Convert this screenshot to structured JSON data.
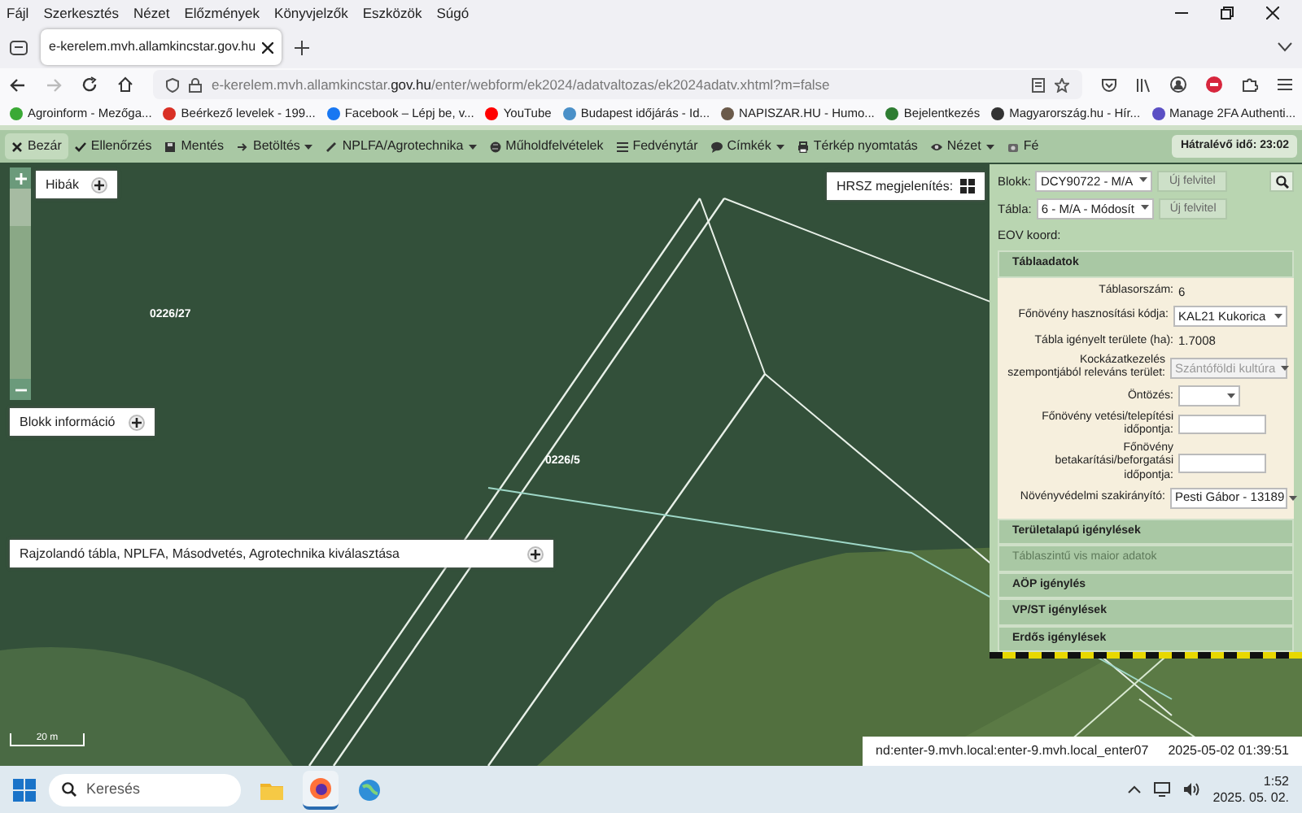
{
  "menu_bar": {
    "items": [
      "Fájl",
      "Szerkesztés",
      "Nézet",
      "Előzmények",
      "Könyvjelzők",
      "Eszközök",
      "Súgó"
    ]
  },
  "tabs": [
    {
      "label": "e-kerelem.mvh.allamkincstar.gov.hu",
      "selected": true
    }
  ],
  "address_bar": {
    "url": "e-kerelem.mvh.allamkincstar.**gov.hu**/enter/webform/ek2024/adatvaltozas/ek2024adatv.xhtml?m=false"
  },
  "bookmarks": [
    {
      "label": "Agroinform - Mezőga...",
      "color": "#3aa935"
    },
    {
      "label": "Beérkező levelek - 199...",
      "color": "#d93025"
    },
    {
      "label": "Facebook – Lépj be, v...",
      "color": "#1877f2"
    },
    {
      "label": "YouTube",
      "color": "#ff0000"
    },
    {
      "label": "Budapest időjárás - Id...",
      "color": "#4a90c8"
    },
    {
      "label": "NAPISZAR.HU - Humo...",
      "color": "#6b5a4a"
    },
    {
      "label": "Bejelentkezés",
      "color": "#2e7d32"
    },
    {
      "label": "Magyarország.hu - Hír...",
      "color": "#333333"
    },
    {
      "label": "Manage 2FA Authenti...",
      "color": "#5b4fc4"
    }
  ],
  "toolbar": {
    "items": [
      {
        "label": "Bezár",
        "kind": "close"
      },
      {
        "label": "Ellenőrzés",
        "kind": "check"
      },
      {
        "label": "Mentés",
        "kind": "save"
      },
      {
        "label": "Betöltés",
        "kind": "load",
        "dropdown": true
      },
      {
        "label": "NPLFA/Agrotechnika",
        "kind": "pencil",
        "dropdown": true
      },
      {
        "label": "Műholdfelvételek",
        "kind": "globe"
      },
      {
        "label": "Fedvénytár",
        "kind": "list"
      },
      {
        "label": "Címkék",
        "kind": "comment",
        "dropdown": true
      },
      {
        "label": "Térkép nyomtatás",
        "kind": "print"
      },
      {
        "label": "Nézet",
        "kind": "eye",
        "dropdown": true
      },
      {
        "label": "Fé",
        "kind": "camera"
      }
    ],
    "session_timer": "Hátralévő idő: 23:02"
  },
  "map": {
    "panels": [
      {
        "label": "Hibák",
        "kind": "errors"
      },
      {
        "label": "Blokk információ",
        "kind": "block"
      },
      {
        "label": "Rajzolandó tábla, NPLFA, Másodvetés, Agrotechnika kiválasztása",
        "kind": "draw"
      }
    ],
    "parcel_labels": [
      "0226/27",
      "0226/5"
    ],
    "hrsz_label": "HRSZ megjelenítés:",
    "scale": "20 m",
    "zoom": {
      "level": 0.8
    },
    "status": {
      "server": "nd:enter-9.mvh.local:enter-9.mvh.local_enter07",
      "timestamp": "2025-05-02 01:39:51"
    }
  },
  "side_panel": {
    "blokk": {
      "label": "Blokk:",
      "value": "DCY90722 - M/A",
      "button": "Új felvitel"
    },
    "tabla": {
      "label": "Tábla:",
      "value": "6 - M/A - Módosít",
      "button": "Új felvitel"
    },
    "eov_label": "EOV koord:",
    "section_title": "Táblaadatok",
    "rows": [
      {
        "label": "Táblasorszám:",
        "kind": "text",
        "value": "6",
        "disabled": false
      },
      {
        "label": "Főnövény hasznosítási kódja:",
        "kind": "select",
        "value": "KAL21 Kukorica",
        "disabled": false
      },
      {
        "label": "Tábla igényelt területe (ha):",
        "kind": "text",
        "value": "1.7008",
        "disabled": false
      },
      {
        "label": "Kockázatkezelés szempontjából releváns terület:",
        "kind": "select",
        "value": "Szántóföldi kultúra",
        "disabled": true
      },
      {
        "label": "Öntözés:",
        "kind": "small_select",
        "disabled": false
      },
      {
        "label": "Főnövény vetési/telepítési időpontja:",
        "kind": "input",
        "disabled": false
      },
      {
        "label": "Főnövény betakarítási/beforgatási időpontja:",
        "kind": "input",
        "disabled": false
      },
      {
        "label": "Növényvédelmi szakirányító:",
        "kind": "select",
        "value": "Pesti Gábor - 13189",
        "disabled": false
      }
    ],
    "sections": [
      {
        "label": "Területalapú igénylések",
        "disabled": false
      },
      {
        "label": "Táblaszintű vis maior adatok",
        "disabled": true
      },
      {
        "label": "AÖP igénylés",
        "disabled": false
      },
      {
        "label": "VP/ST igénylések",
        "disabled": false
      },
      {
        "label": "Erdős igénylések",
        "disabled": false
      }
    ]
  },
  "taskbar": {
    "search_placeholder": "Keresés",
    "apps": [
      {
        "kind": "folder",
        "selected": false
      },
      {
        "kind": "firefox",
        "selected": true
      },
      {
        "kind": "globe",
        "selected": false
      }
    ],
    "time": "1:52",
    "date": "2025. 05. 02."
  }
}
